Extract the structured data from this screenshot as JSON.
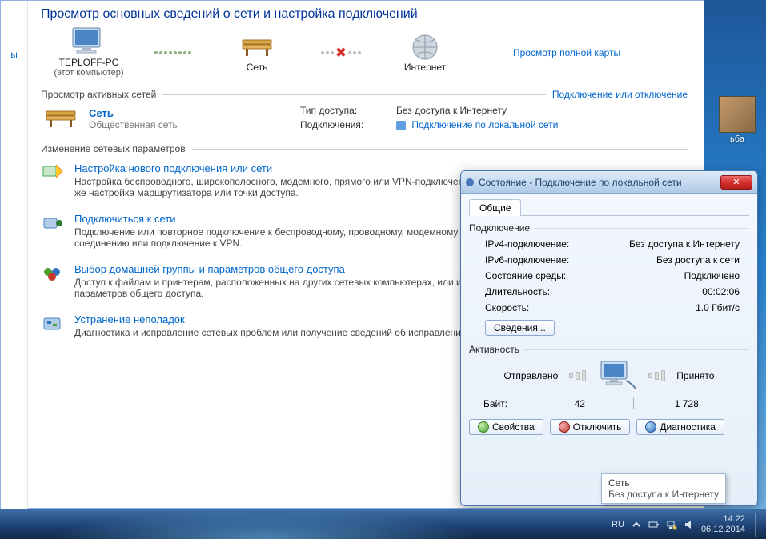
{
  "sidebar": {
    "partial_text": "ы"
  },
  "page": {
    "title": "Просмотр основных сведений о сети и настройка подключений",
    "map": {
      "full_map_link": "Просмотр полной карты",
      "node_pc": "TEPLOFF-PC",
      "node_pc_sub": "(этот компьютер)",
      "node_network": "Сеть",
      "node_internet": "Интернет"
    },
    "active_nets": {
      "section": "Просмотр активных сетей",
      "connect_link": "Подключение или отключение",
      "net_name": "Сеть",
      "net_type": "Общественная сеть",
      "access_label": "Тип доступа:",
      "access_value": "Без доступа к Интернету",
      "conn_label": "Подключения:",
      "conn_value": "Подключение по локальной сети"
    },
    "change": {
      "section": "Изменение сетевых параметров",
      "items": [
        {
          "title": "Настройка нового подключения или сети",
          "desc": "Настройка беспроводного, широкополосного, модемного, прямого или VPN-подключения или же настройка маршрутизатора или точки доступа."
        },
        {
          "title": "Подключиться к сети",
          "desc": "Подключение или повторное подключение к беспроводному, проводному, модемному сетевому соединению или подключение к VPN."
        },
        {
          "title": "Выбор домашней группы и параметров общего доступа",
          "desc": "Доступ к файлам и принтерам, расположенных на других сетевых компьютерах, или изменение параметров общего доступа."
        },
        {
          "title": "Устранение неполадок",
          "desc": "Диагностика и исправление сетевых проблем или получение сведений об исправлении."
        }
      ]
    }
  },
  "dialog": {
    "title": "Состояние - Подключение по локальной сети",
    "tab_general": "Общие",
    "group_conn": "Подключение",
    "rows": {
      "ipv4_k": "IPv4-подключение:",
      "ipv4_v": "Без доступа к Интернету",
      "ipv6_k": "IPv6-подключение:",
      "ipv6_v": "Без доступа к сети",
      "media_k": "Состояние среды:",
      "media_v": "Подключено",
      "dur_k": "Длительность:",
      "dur_v": "00:02:06",
      "speed_k": "Скорость:",
      "speed_v": "1.0 Гбит/с"
    },
    "details_btn": "Сведения...",
    "group_activity": "Активность",
    "activity": {
      "sent_label": "Отправлено",
      "recv_label": "Принято",
      "bytes_label": "Байт:",
      "sent_bytes": "42",
      "recv_bytes": "1 728"
    },
    "btns": {
      "props": "Свойства",
      "disable": "Отключить",
      "diag": "Диагностика"
    }
  },
  "tooltip": {
    "line1": "Сеть",
    "line2": "Без доступа к Интернету"
  },
  "desktop": {
    "icon_label": "ьба"
  },
  "tray": {
    "lang": "RU",
    "time": "14:22",
    "date": "06.12.2014"
  }
}
